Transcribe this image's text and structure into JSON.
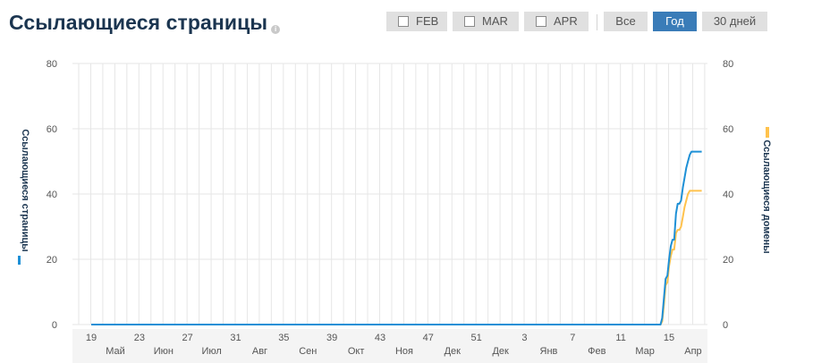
{
  "title": "Ссылающиеся страницы",
  "info_icon": "info-icon",
  "months": [
    {
      "label": "FEB",
      "checked": false
    },
    {
      "label": "MAR",
      "checked": false
    },
    {
      "label": "APR",
      "checked": false
    }
  ],
  "ranges": [
    {
      "label": "Все",
      "active": false
    },
    {
      "label": "Год",
      "active": true
    },
    {
      "label": "30 дней",
      "active": false
    }
  ],
  "colors": {
    "pages": "#1e90d6",
    "domains": "#ffc24d",
    "grid": "#e6e6e6"
  },
  "chart_data": {
    "type": "line",
    "ylim": [
      0,
      80
    ],
    "yticks": [
      "0",
      "20",
      "40",
      "60",
      "80"
    ],
    "x_week_ticks": [
      "19",
      "23",
      "27",
      "31",
      "35",
      "39",
      "43",
      "47",
      "51",
      "3",
      "7",
      "11",
      "15"
    ],
    "x_month_ticks": [
      "Май",
      "Июн",
      "Июл",
      "Авг",
      "Сен",
      "Окт",
      "Ноя",
      "Дек",
      "Дек",
      "Янв",
      "Фев",
      "Мар",
      "Апр"
    ],
    "left_axis_label": "Ссылающиеся страницы",
    "right_axis_label": "Ссылающиеся домены",
    "x": [
      "2023-04-19",
      "2024-03-14",
      "2024-03-15",
      "2024-03-16",
      "2024-03-17",
      "2024-03-18",
      "2024-03-19",
      "2024-03-20",
      "2024-03-21",
      "2024-03-22",
      "2024-03-23",
      "2024-03-24",
      "2024-03-25",
      "2024-03-26",
      "2024-03-27",
      "2024-03-28",
      "2024-03-29",
      "2024-03-30",
      "2024-03-31",
      "2024-04-01",
      "2024-04-02",
      "2024-04-03",
      "2024-04-04",
      "2024-04-05",
      "2024-04-06",
      "2024-04-07",
      "2024-04-08"
    ],
    "series": [
      {
        "name": "Ссылающиеся страницы",
        "values": [
          0,
          0,
          0,
          2,
          8,
          14,
          15,
          20,
          24,
          26,
          26,
          34,
          37,
          37,
          38,
          42,
          45,
          48,
          50,
          52,
          53,
          53,
          53,
          53,
          53,
          53,
          53
        ]
      },
      {
        "name": "Ссылающиеся домены",
        "values": [
          0,
          0,
          0,
          1,
          6,
          12,
          13,
          18,
          21,
          23,
          23,
          28,
          29,
          29,
          30,
          33,
          36,
          38,
          40,
          41,
          41,
          41,
          41,
          41,
          41,
          41,
          41
        ]
      }
    ]
  }
}
